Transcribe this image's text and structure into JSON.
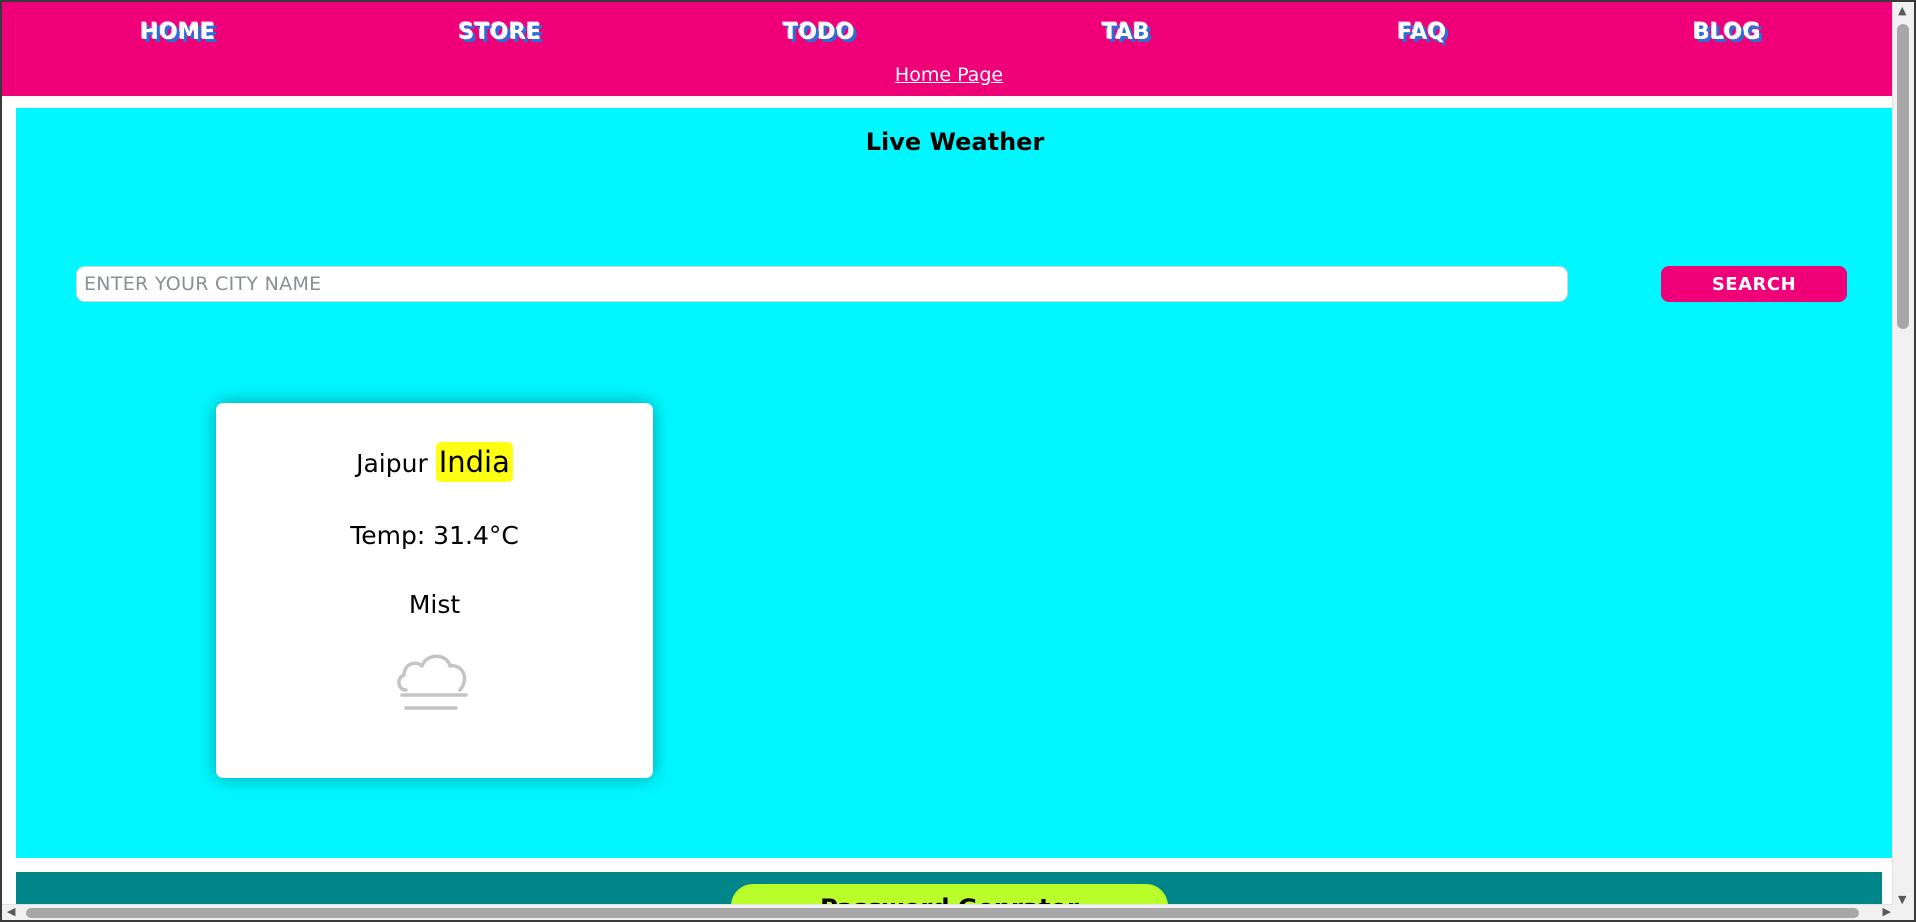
{
  "nav": {
    "items": [
      {
        "label": "HOME"
      },
      {
        "label": "STORE"
      },
      {
        "label": "TODO"
      },
      {
        "label": "TAB"
      },
      {
        "label": "FAQ"
      },
      {
        "label": "BLOG"
      }
    ],
    "home_link": "Home Page"
  },
  "weather": {
    "title": "Live Weather",
    "search_placeholder": "ENTER YOUR CITY NAME",
    "search_value": "",
    "search_button": "SEARCH",
    "card": {
      "city": "Jaipur",
      "country": "India",
      "temp": "Temp: 31.4°C",
      "condition": "Mist",
      "icon": "mist-cloud-icon"
    }
  },
  "password": {
    "title": "Password Genrator"
  },
  "colors": {
    "header": "#ef0078",
    "weather_bg": "#00f7ff",
    "country_highlight": "#ffff13",
    "password_bg": "#008688",
    "password_pill": "#b8ff2b"
  }
}
